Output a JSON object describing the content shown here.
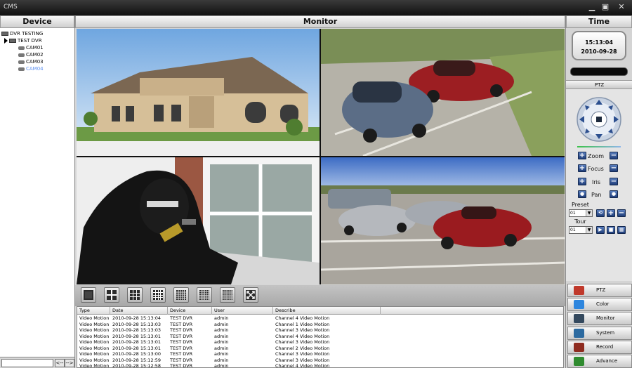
{
  "window": {
    "title": "CMS",
    "controls": [
      "minimize",
      "restore",
      "close"
    ]
  },
  "device_panel": {
    "header": "Device",
    "tree": [
      {
        "label": "DVR TESTING",
        "level": 0,
        "kind": "group"
      },
      {
        "label": "TEST DVR",
        "level": 1,
        "kind": "dvr",
        "expanded": true
      },
      {
        "label": "CAM01",
        "level": 2,
        "kind": "camera"
      },
      {
        "label": "CAM02",
        "level": 2,
        "kind": "camera"
      },
      {
        "label": "CAM03",
        "level": 2,
        "kind": "camera"
      },
      {
        "label": "CAM04",
        "level": 2,
        "kind": "camera",
        "selected": true
      }
    ],
    "footer": {
      "prev_label": "<--",
      "next_label": "-->"
    }
  },
  "monitor": {
    "header": "Monitor",
    "feeds": [
      {
        "channel": 1,
        "scene": "office building exterior"
      },
      {
        "channel": 2,
        "scene": "two cars in parking lot"
      },
      {
        "channel": 3,
        "scene": "masked burglar breaking window"
      },
      {
        "channel": 4,
        "scene": "cars parked in lot"
      }
    ],
    "layout_buttons": [
      "layout-1-icon",
      "layout-4-icon",
      "layout-9-icon",
      "layout-16-icon",
      "layout-25-icon",
      "layout-36-icon",
      "layout-64-icon",
      "fullscreen-icon"
    ]
  },
  "events": {
    "columns": [
      "Type",
      "Date",
      "Device",
      "User",
      "Describe"
    ],
    "rows": [
      [
        "Video Motion",
        "2010-09-28 15:13:04",
        "TEST DVR",
        "admin",
        "Channel 4 Video Motion"
      ],
      [
        "Video Motion",
        "2010-09-28 15:13:03",
        "TEST DVR",
        "admin",
        "Channel 1 Video Motion"
      ],
      [
        "Video Motion",
        "2010-09-28 15:13:03",
        "TEST DVR",
        "admin",
        "Channel 3 Video Motion"
      ],
      [
        "Video Motion",
        "2010-09-28 15:13:01",
        "TEST DVR",
        "admin",
        "Channel 4 Video Motion"
      ],
      [
        "Video Motion",
        "2010-09-28 15:13:01",
        "TEST DVR",
        "admin",
        "Channel 3 Video Motion"
      ],
      [
        "Video Motion",
        "2010-09-28 15:13:01",
        "TEST DVR",
        "admin",
        "Channel 2 Video Motion"
      ],
      [
        "Video Motion",
        "2010-09-28 15:13:00",
        "TEST DVR",
        "admin",
        "Channel 3 Video Motion"
      ],
      [
        "Video Motion",
        "2010-09-28 15:12:59",
        "TEST DVR",
        "admin",
        "Channel 3 Video Motion"
      ],
      [
        "Video Motion",
        "2010-09-28 15:12:58",
        "TEST DVR",
        "admin",
        "Channel 4 Video Motion"
      ]
    ]
  },
  "time_panel": {
    "header": "Time",
    "time": "15:13:04",
    "date": "2010-09-28"
  },
  "ptz": {
    "header": "PTZ",
    "controls": [
      {
        "label": "Zoom"
      },
      {
        "label": "Focus"
      },
      {
        "label": "Iris"
      },
      {
        "label": "Pan"
      }
    ],
    "preset": {
      "label": "Preset",
      "value": "01"
    },
    "tour": {
      "label": "Tour",
      "value": "01"
    }
  },
  "nav": [
    {
      "label": "PTZ",
      "icon": "ptz-icon",
      "color": "#c0392b"
    },
    {
      "label": "Color",
      "icon": "color-wheel-icon",
      "color": "#2e86de"
    },
    {
      "label": "Monitor",
      "icon": "monitor-icon",
      "color": "#34495e"
    },
    {
      "label": "System",
      "icon": "system-icon",
      "color": "#2c6aa0"
    },
    {
      "label": "Record",
      "icon": "record-icon",
      "color": "#8e2b1f"
    },
    {
      "label": "Advance",
      "icon": "advance-icon",
      "color": "#2f8b2f"
    }
  ]
}
